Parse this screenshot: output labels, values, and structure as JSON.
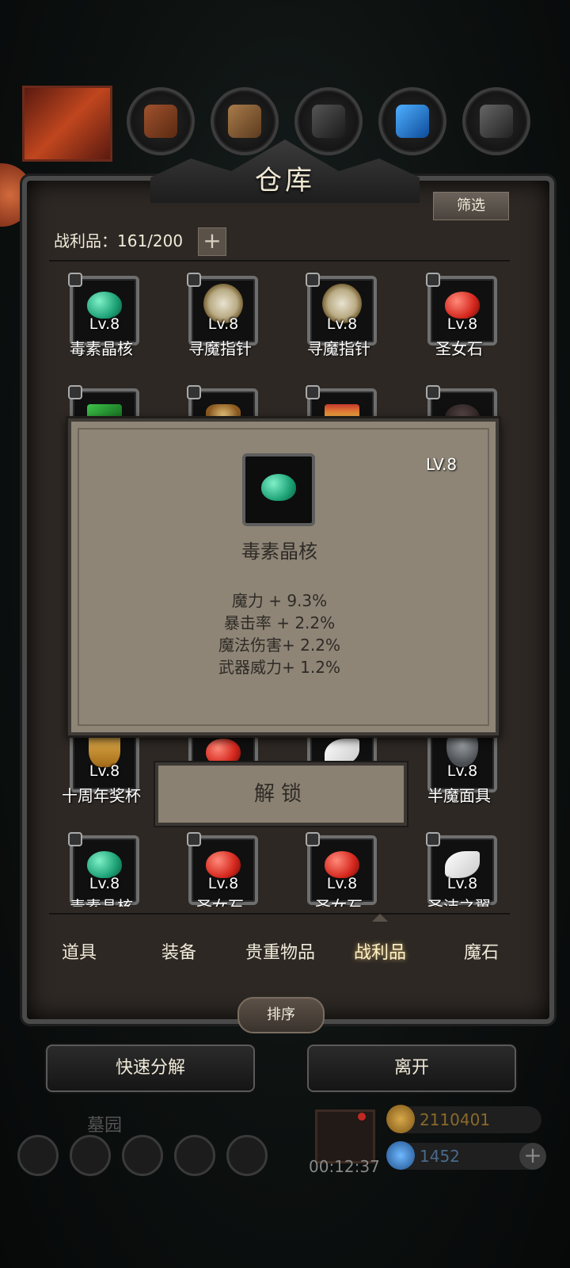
{
  "panel": {
    "title": "仓库",
    "filter_label": "筛选",
    "loot_count": "战利品：161/200",
    "add_label": "+"
  },
  "items_row1": [
    {
      "name": "毒素晶核",
      "lv": "Lv.8"
    },
    {
      "name": "寻魔指针",
      "lv": "Lv.8"
    },
    {
      "name": "寻魔指针",
      "lv": "Lv.8"
    },
    {
      "name": "圣女石",
      "lv": "Lv.8"
    }
  ],
  "items_row4": [
    {
      "name": "十周年奖杯",
      "lv": "Lv.8"
    },
    {
      "name": "半魔面具",
      "lv": "Lv.8"
    }
  ],
  "items_row5": [
    {
      "name": "毒素晶核",
      "lv": "Lv.8"
    },
    {
      "name": "圣女石",
      "lv": "Lv.8"
    },
    {
      "name": "圣女石",
      "lv": "Lv.8"
    },
    {
      "name": "圣洁之翼",
      "lv": "Lv.8"
    }
  ],
  "popup": {
    "lv": "LV.8",
    "name": "毒素晶核",
    "stats": [
      "魔力 + 9.3%",
      "暴击率 + 2.2%",
      "魔法伤害+ 2.2%",
      "武器威力+ 1.2%"
    ],
    "unlock_label": "解锁"
  },
  "tabs": [
    "道具",
    "装备",
    "贵重物品",
    "战利品",
    "魔石"
  ],
  "active_tab": "战利品",
  "sort_label": "排序",
  "quick_decompose_label": "快速分解",
  "leave_label": "离开",
  "hud": {
    "location": "墓园",
    "timer": "00:12:37",
    "gold": "2110401",
    "gems": "1452",
    "add": "+"
  },
  "colors": {
    "panel": "#2d2824",
    "popup": "#8e8576",
    "accent": "#d7b46a"
  }
}
